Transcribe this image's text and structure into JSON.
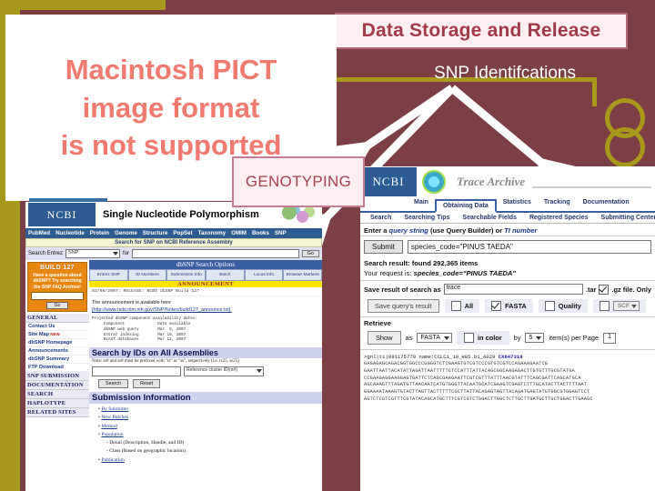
{
  "slide": {
    "background_color": "#7d3f46",
    "accent_color": "#a8991b",
    "title": "Data Storage and Release",
    "section_heading": "SNP Identifcations",
    "callout": "GENOTYPING"
  },
  "broken_image": {
    "line1": "Macintosh PICT",
    "line2": "image format",
    "line3": "is not supported"
  },
  "dbsnp": {
    "logo": "NCBI",
    "title": "Single Nucleotide Polymorphism",
    "nav": [
      "PubMed",
      "Nucleotide",
      "Protein",
      "Genome",
      "Structure",
      "PopSet",
      "Taxonomy",
      "OMIM",
      "Books",
      "SNP"
    ],
    "search_assembly_bar": "Search for SNP on NCBI Reference Assembly",
    "entrez_label": "Search Entrez",
    "entrez_value": "SNP",
    "entrez_for": "for",
    "entrez_go": "Go",
    "sidebar": {
      "build": "BUILD 127",
      "faq_note": "Have a question about dbSNP? Try searching the SNP FAQ Archive!",
      "faq_go": "Go",
      "sections": [
        {
          "type": "head",
          "label": "GENERAL"
        },
        {
          "type": "link",
          "label": "Contact Us"
        },
        {
          "type": "link",
          "label": "Site Map",
          "badge": "NEW"
        },
        {
          "type": "link",
          "label": "dbSNP Homepage"
        },
        {
          "type": "link",
          "label": "Announcements"
        },
        {
          "type": "link",
          "label": "dbSNP Summary"
        },
        {
          "type": "link",
          "label": "FTP Download"
        },
        {
          "type": "head",
          "label": "SNP SUBMISSION"
        },
        {
          "type": "head",
          "label": "DOCUMENTATION"
        },
        {
          "type": "head",
          "label": "SEARCH"
        },
        {
          "type": "head",
          "label": "HAPLOTYPE"
        },
        {
          "type": "head",
          "label": "RELATED SITES"
        }
      ]
    },
    "search_options_bar": "dbSNP Search Options",
    "option_tabs": [
      "Entrez SNP",
      "ID Numbers",
      "Submission Info",
      "Batch",
      "Locus Info",
      "Browser Markers"
    ],
    "announcement_head": "ANNOUNCEMENT",
    "announcement_release": "03/06/2007: RELEASE: NCBI dbSNP Build 127",
    "announcement_body": "The announcement is available here",
    "announcement_link": "[http://www.ncbi.nlm.nih.gov/SNP/Notes/build127_announce.txt].",
    "availability_pre": "Projected dbSNP component availability dates:\n     Component              Date available\n     dbSNP web query        Mar  8, 2007\n     Entrez indexing        Mar 10, 2007\n     BLAST databases        Mar 12, 2007",
    "search_ids_head": "Search by IDs on All Assemblies",
    "search_ids_note": "Note: rs# and ss# must be prefixed with \"rs\" or \"ss\", respectively (i.e. rs25, ss25)",
    "cluster_select": "Reference cluster ID(rs#)",
    "search_button": "Search",
    "reset_button": "Reset",
    "submission_head": "Submission Information",
    "submission_links": [
      "By Submitter",
      "New Batches",
      "Method",
      "Population",
      "Publication"
    ],
    "submission_sub": [
      "- Detail (Description, Handle, and ID)",
      "- Class (Based on geographic location)"
    ]
  },
  "trace": {
    "logo": "NCBI",
    "title": "Trace Archive",
    "nav_primary": [
      "Main",
      "Obtaining Data",
      "Statistics",
      "Tracking",
      "Documentation"
    ],
    "nav_primary_active": "Obtaining Data",
    "nav_secondary": [
      "Search",
      "Searching Tips",
      "Searchable Fields",
      "Registered Species",
      "Submitting Centers"
    ],
    "query_prompt_a": "Enter a ",
    "query_prompt_b": "query string",
    "query_prompt_c": " (use Query Builder) or ",
    "query_prompt_d": "TI number",
    "submit_button": "Submit",
    "query_value": "species_code=\"PINUS TAEDA\"",
    "result_text": "Search result: found 292,365 items",
    "request_label": "Your request is: ",
    "request_value": "species_code=\"PINUS TAEDA\"",
    "save_label": "Save result of search as",
    "save_value": "trace",
    "save_tar": ".tar",
    "save_gz": ".gz file. Only",
    "save_query_button": "Save query's result",
    "checkbox_all": "All",
    "checkbox_fasta": "FASTA",
    "checkbox_quality": "Quality",
    "checkbox_scf": "SCF",
    "retrieve_head": "Retrieve",
    "show_button": "Show",
    "show_as": "as",
    "show_format": "FASTA",
    "in_color": "in color",
    "by_label": "by",
    "by_value": "5",
    "items_per_page": "item(s) per Page",
    "page_value": "1",
    "seq_header_a": ">gnl|ti|091175779 name:CCLC1_19_H05.b1_A029 ",
    "seq_header_b": "CX647319",
    "seq_lines": [
      "GAGAGAGCAGACGGTGGCCCGGGGTCTCGAAGTGTCGTCCCGTGTCGTCCAGAAAGAATCG",
      "GAATTAATTACATATTAGATTAATTTTTCTCCATTTATTACAGCGGCAAGAGACTTGTGTTTGCGTATGA",
      "CCGAAGAGGAAGGAGTGATTCTCAGCGAAGAATTCGTCGTTTATTTAACGTATTTCAGCGATTCAGCATGCA",
      "AGCAAAGTTTAGATGTTAACAATCATGTGGGTTACAATGCATCGAAGTCGAGTCTTTGCATACTTACTTTTAAT",
      "GGAAAATAAAGTGTACTTAGTTACTTTTTCGCTTATTACAGAGTAGTTACAGATGAGTATGTGGCGTGGAGTCCT",
      "AGTCTCGTCGTTTCGTATACAGCATGCTTTCGTCGTCTGGACTTGGCTCTTGCTTGATGCTTGCTGGACTTGAAGC"
    ]
  }
}
